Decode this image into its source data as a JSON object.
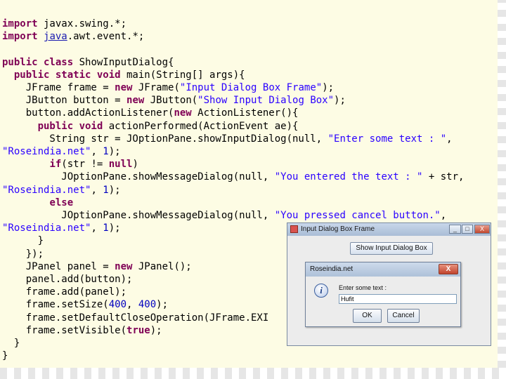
{
  "code": {
    "lines": [
      [
        {
          "c": "kw",
          "t": "import"
        },
        {
          "c": "txt",
          "t": " javax.swing.*;"
        }
      ],
      [
        {
          "c": "kw",
          "t": "import"
        },
        {
          "c": "txt",
          "t": " "
        },
        {
          "c": "link",
          "t": "java"
        },
        {
          "c": "txt",
          "t": ".awt.event.*;"
        }
      ],
      [],
      [
        {
          "c": "kw",
          "t": "public class"
        },
        {
          "c": "txt",
          "t": " ShowInputDialog{"
        }
      ],
      [
        {
          "c": "txt",
          "t": "  "
        },
        {
          "c": "kw",
          "t": "public static void"
        },
        {
          "c": "txt",
          "t": " main(String[] args){"
        }
      ],
      [
        {
          "c": "txt",
          "t": "    JFrame frame = "
        },
        {
          "c": "kw",
          "t": "new"
        },
        {
          "c": "txt",
          "t": " JFrame("
        },
        {
          "c": "str",
          "t": "\"Input Dialog Box Frame\""
        },
        {
          "c": "txt",
          "t": ");"
        }
      ],
      [
        {
          "c": "txt",
          "t": "    JButton button = "
        },
        {
          "c": "kw",
          "t": "new"
        },
        {
          "c": "txt",
          "t": " JButton("
        },
        {
          "c": "str",
          "t": "\"Show Input Dialog Box\""
        },
        {
          "c": "txt",
          "t": ");"
        }
      ],
      [
        {
          "c": "txt",
          "t": "    button.addActionListener("
        },
        {
          "c": "kw",
          "t": "new"
        },
        {
          "c": "txt",
          "t": " ActionListener(){"
        }
      ],
      [
        {
          "c": "txt",
          "t": "      "
        },
        {
          "c": "kw",
          "t": "public void"
        },
        {
          "c": "txt",
          "t": " actionPerformed(ActionEvent ae){"
        }
      ],
      [
        {
          "c": "txt",
          "t": "        String str = JOptionPane.showInputDialog(null, "
        },
        {
          "c": "str",
          "t": "\"Enter some text : \""
        },
        {
          "c": "txt",
          "t": ","
        }
      ],
      [
        {
          "c": "str",
          "t": "\"Roseindia.net\""
        },
        {
          "c": "txt",
          "t": ", "
        },
        {
          "c": "num",
          "t": "1"
        },
        {
          "c": "txt",
          "t": ");"
        }
      ],
      [
        {
          "c": "txt",
          "t": "        "
        },
        {
          "c": "kw",
          "t": "if"
        },
        {
          "c": "txt",
          "t": "(str != "
        },
        {
          "c": "kw",
          "t": "null"
        },
        {
          "c": "txt",
          "t": ")"
        }
      ],
      [
        {
          "c": "txt",
          "t": "          JOptionPane.showMessageDialog(null, "
        },
        {
          "c": "str",
          "t": "\"You entered the text : \""
        },
        {
          "c": "txt",
          "t": " + str,"
        }
      ],
      [
        {
          "c": "str",
          "t": "\"Roseindia.net\""
        },
        {
          "c": "txt",
          "t": ", "
        },
        {
          "c": "num",
          "t": "1"
        },
        {
          "c": "txt",
          "t": ");"
        }
      ],
      [
        {
          "c": "txt",
          "t": "        "
        },
        {
          "c": "kw",
          "t": "else"
        }
      ],
      [
        {
          "c": "txt",
          "t": "          JOptionPane.showMessageDialog(null, "
        },
        {
          "c": "str",
          "t": "\"You pressed cancel button.\""
        },
        {
          "c": "txt",
          "t": ","
        }
      ],
      [
        {
          "c": "str",
          "t": "\"Roseindia.net\""
        },
        {
          "c": "txt",
          "t": ", "
        },
        {
          "c": "num",
          "t": "1"
        },
        {
          "c": "txt",
          "t": ");"
        }
      ],
      [
        {
          "c": "txt",
          "t": "      }"
        }
      ],
      [
        {
          "c": "txt",
          "t": "    });"
        }
      ],
      [
        {
          "c": "txt",
          "t": "    JPanel panel = "
        },
        {
          "c": "kw",
          "t": "new"
        },
        {
          "c": "txt",
          "t": " JPanel();"
        }
      ],
      [
        {
          "c": "txt",
          "t": "    panel.add(button);"
        }
      ],
      [
        {
          "c": "txt",
          "t": "    frame.add(panel);"
        }
      ],
      [
        {
          "c": "txt",
          "t": "    frame.setSize("
        },
        {
          "c": "num",
          "t": "400"
        },
        {
          "c": "txt",
          "t": ", "
        },
        {
          "c": "num",
          "t": "400"
        },
        {
          "c": "txt",
          "t": ");"
        }
      ],
      [
        {
          "c": "txt",
          "t": "    frame.setDefaultCloseOperation(JFrame.EXI"
        }
      ],
      [
        {
          "c": "txt",
          "t": "    frame.setVisible("
        },
        {
          "c": "kw",
          "t": "true"
        },
        {
          "c": "txt",
          "t": ");"
        }
      ],
      [
        {
          "c": "txt",
          "t": "  }"
        }
      ],
      [
        {
          "c": "txt",
          "t": "}"
        }
      ]
    ]
  },
  "frame": {
    "title": "Input Dialog Box Frame",
    "minimize": "_",
    "maximize": "□",
    "close": "X",
    "button_label": "Show Input Dialog Box"
  },
  "dialog": {
    "title": "Roseindia.net",
    "close": "X",
    "icon_glyph": "i",
    "prompt": "Enter some text :",
    "input_value": "Hufit",
    "ok_label": "OK",
    "cancel_label": "Cancel"
  },
  "colors": {
    "background": "#fdfce4",
    "keyword": "#7f0055",
    "string": "#2a00ff",
    "number": "#0000c0"
  }
}
